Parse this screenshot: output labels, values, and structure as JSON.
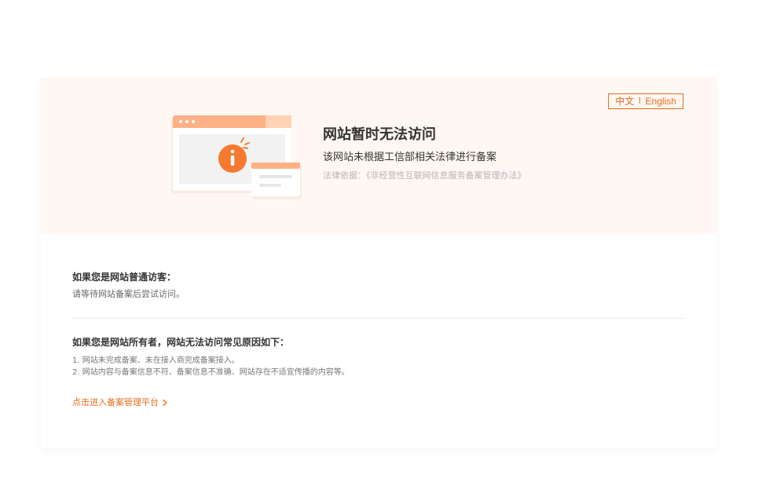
{
  "language_switch": {
    "zh_label": "中文",
    "separator": "l",
    "en_label": "English"
  },
  "hero": {
    "title": "网站暂时无法访问",
    "subtitle": "该网站未根据工信部相关法律进行备案",
    "law": "法律依据：《非经营性互联网信息服务备案管理办法》",
    "illustration": {
      "icon": "info-icon",
      "accent": "#f57a2f"
    }
  },
  "visitor_section": {
    "title": "如果您是网站普通访客：",
    "body": "请等待网站备案后尝试访问。"
  },
  "owner_section": {
    "title": "如果您是网站所有者，网站无法访问常见原因如下：",
    "reasons": [
      "1. 网站未完成备案、未在接入商完成备案接入。",
      "2. 网站内容与备案信息不符、备案信息不准确、网站存在不适宜传播的内容等。"
    ]
  },
  "link": {
    "label": "点击进入备案管理平台",
    "icon": "chevron-right-icon"
  },
  "colors": {
    "accent": "#ea6b1c",
    "hero_background": "#fff7f3",
    "text_primary": "#333333",
    "text_secondary": "#777777"
  }
}
